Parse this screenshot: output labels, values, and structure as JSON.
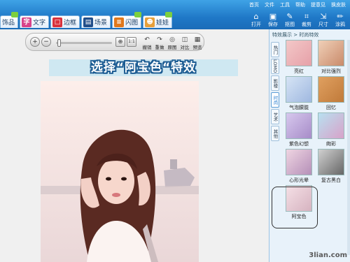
{
  "top_links": [
    "首页",
    "文件",
    "工具",
    "帮助",
    "提意见",
    "换皮肤"
  ],
  "tabs": [
    {
      "label": "饰品",
      "icon": "decoration-icon",
      "color": "#e35c9c",
      "badge": true,
      "glyph": ""
    },
    {
      "label": "文字",
      "icon": "text-icon",
      "color": "#d8438a",
      "badge": false,
      "glyph": "字"
    },
    {
      "label": "边框",
      "icon": "frame-icon",
      "color": "#d9323c",
      "badge": false,
      "glyph": "□"
    },
    {
      "label": "场景",
      "icon": "scene-icon",
      "color": "#234f8a",
      "badge": false,
      "glyph": "▤"
    },
    {
      "label": "闪图",
      "icon": "flash-icon",
      "color": "#e0781c",
      "badge": true,
      "glyph": "≡"
    },
    {
      "label": "娃娃",
      "icon": "doll-icon",
      "color": "#e7a03a",
      "badge": true,
      "glyph": "☻"
    }
  ],
  "right_tools": [
    {
      "label": "打开",
      "icon": "open-icon",
      "glyph": "⌂"
    },
    {
      "label": "保存",
      "icon": "save-icon",
      "glyph": "▣"
    },
    {
      "label": "抠图",
      "icon": "cutout-icon",
      "glyph": "✎"
    },
    {
      "label": "裁剪",
      "icon": "crop-icon",
      "glyph": "⌗"
    },
    {
      "label": "尺寸",
      "icon": "resize-icon",
      "glyph": "⇲"
    },
    {
      "label": "涂鸦",
      "icon": "doodle-icon",
      "glyph": "✏"
    }
  ],
  "toolbar": {
    "buttons": [
      {
        "label": "撤销",
        "icon": "undo-icon",
        "glyph": "↶"
      },
      {
        "label": "重做",
        "icon": "redo-icon",
        "glyph": "↷"
      },
      {
        "label": "原图",
        "icon": "original-icon",
        "glyph": "◎"
      },
      {
        "label": "对比",
        "icon": "compare-icon",
        "glyph": "◫"
      },
      {
        "label": "预览",
        "icon": "preview-icon",
        "glyph": "▦"
      }
    ],
    "zoom_in_glyph": "+",
    "zoom_out_glyph": "−",
    "fit_glyph": "⊕",
    "actual_glyph": "1:1"
  },
  "banner": "选择“阿宝色“特效",
  "panel": {
    "header": "特效展示 > 时尚特效",
    "categories": [
      "热门",
      "LOMO",
      "影楼",
      "时尚",
      "艺术",
      "其他"
    ],
    "active_category_index": 3,
    "effects": [
      {
        "label": "亮红",
        "color": "#e6a0a8"
      },
      {
        "label": "对比强烈",
        "color": "#c98a6a"
      },
      {
        "label": "气泡朦胧",
        "color": "#9fb8e0"
      },
      {
        "label": "回忆",
        "color": "#c07a3a"
      },
      {
        "label": "紫色幻想",
        "color": "#a78cc8"
      },
      {
        "label": "绚彩",
        "color": "#d8a2c9"
      },
      {
        "label": "心形光晕",
        "color": "#b58fb8"
      },
      {
        "label": "复古黑白",
        "color": "#888888"
      },
      {
        "label": "阿宝色",
        "color": "#d6b3c0"
      }
    ],
    "selected_index": 8
  },
  "watermark": "3lian.com"
}
